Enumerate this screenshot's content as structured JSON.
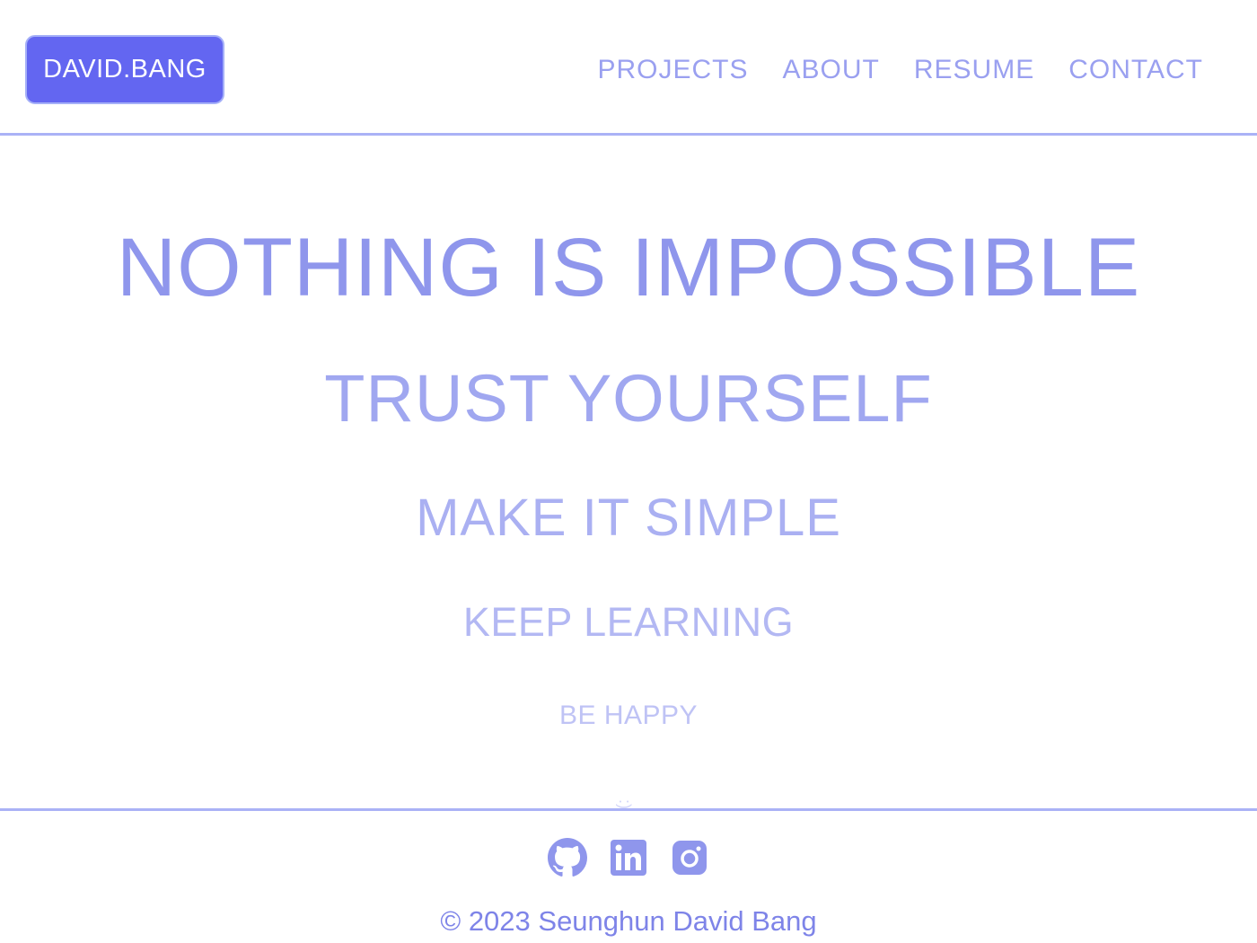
{
  "header": {
    "logo": "DAVID.BANG",
    "nav": [
      {
        "label": "PROJECTS"
      },
      {
        "label": "ABOUT"
      },
      {
        "label": "RESUME"
      },
      {
        "label": "CONTACT"
      }
    ]
  },
  "main": {
    "lines": [
      "NOTHING IS IMPOSSIBLE",
      "TRUST YOURSELF",
      "MAKE IT SIMPLE",
      "KEEP LEARNING",
      "BE HAPPY"
    ],
    "smile": ":)"
  },
  "footer": {
    "socials": [
      {
        "icon": "github-icon"
      },
      {
        "icon": "linkedin-icon"
      },
      {
        "icon": "instagram-icon"
      }
    ],
    "copyright": "© 2023 Seunghun David Bang"
  },
  "colors": {
    "accent": "#6366f1",
    "text_primary": "#8f96ec",
    "divider": "#aab2f6"
  }
}
